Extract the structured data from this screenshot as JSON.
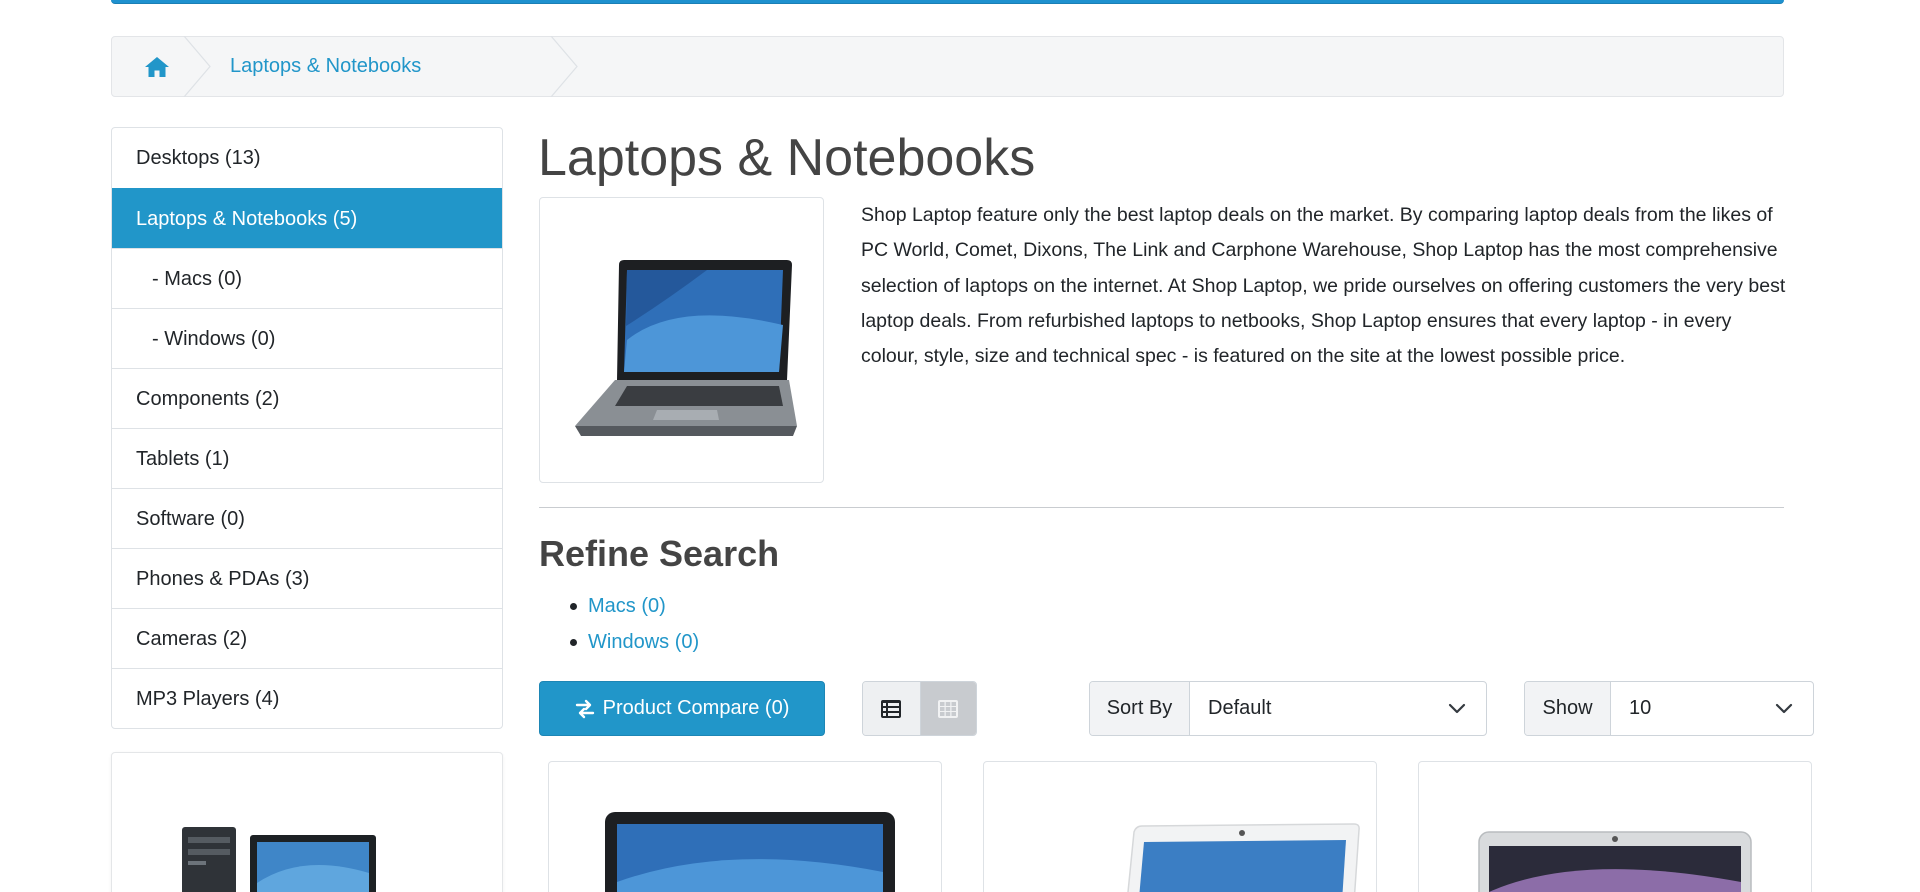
{
  "breadcrumb": {
    "home_icon": "home-icon",
    "current": "Laptops & Notebooks"
  },
  "sidebar": {
    "items": [
      {
        "label": "Desktops (13)"
      },
      {
        "label": "Laptops & Notebooks (5)"
      },
      {
        "label": "- Macs (0)"
      },
      {
        "label": "- Windows (0)"
      },
      {
        "label": "Components (2)"
      },
      {
        "label": "Tablets (1)"
      },
      {
        "label": "Software (0)"
      },
      {
        "label": "Phones & PDAs (3)"
      },
      {
        "label": "Cameras (2)"
      },
      {
        "label": "MP3 Players (4)"
      }
    ]
  },
  "category": {
    "title": "Laptops & Notebooks",
    "description": "Shop Laptop feature only the best laptop deals on the market. By comparing laptop deals from the likes of PC World, Comet, Dixons, The Link and Carphone Warehouse, Shop Laptop has the most comprehensive selection of laptops on the internet. At Shop Laptop, we pride ourselves on offering customers the very best laptop deals. From refurbished laptops to netbooks, Shop Laptop ensures that every laptop - in every colour, style, size and technical spec - is featured on the site at the lowest possible price."
  },
  "refine": {
    "title": "Refine Search",
    "links": [
      "Macs (0)",
      "Windows (0)"
    ]
  },
  "toolbar": {
    "compare_label": "Product Compare (0)",
    "sort_label": "Sort By",
    "sort_value": "Default",
    "show_label": "Show",
    "show_value": "10",
    "list_view_icon": "list-icon",
    "grid_view_icon": "grid-icon"
  },
  "colors": {
    "accent": "#2196c9",
    "text": "#212529",
    "heading": "#444444"
  }
}
